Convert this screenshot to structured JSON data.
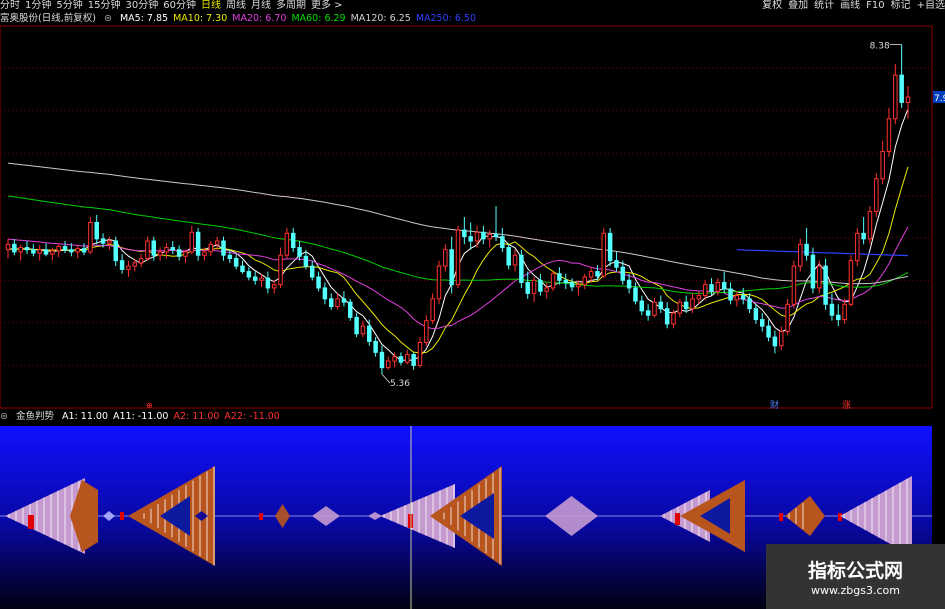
{
  "toolbar": {
    "periods": [
      "分时",
      "1分钟",
      "5分钟",
      "15分钟",
      "30分钟",
      "60分钟",
      "日线",
      "周线",
      "月线",
      "多周期",
      "更多 >"
    ],
    "active_period": "日线",
    "tools": [
      "复权",
      "叠加",
      "统计",
      "画线",
      "F10",
      "标记",
      "+自选"
    ]
  },
  "main_chart": {
    "title": "富奥股份(日线,前复权)",
    "ma_labels": [
      {
        "text": "MA5: 7.85",
        "color": "#ffffff"
      },
      {
        "text": "MA10: 7.30",
        "color": "#e8e800"
      },
      {
        "text": "MA20: 6.70",
        "color": "#e040e0"
      },
      {
        "text": "MA60: 6.29",
        "color": "#00e000"
      },
      {
        "text": "MA120: 6.25",
        "color": "#d0d0d0"
      },
      {
        "text": "MA250: 6.50",
        "color": "#3040ff"
      }
    ],
    "high_label": "8.38",
    "low_label": "5.36",
    "right_price": "7.9",
    "markers": [
      {
        "text": "财",
        "color": "#4a7cff"
      },
      {
        "text": "涨",
        "color": "#ff3030"
      }
    ],
    "small_marker": "⊕"
  },
  "sub_chart": {
    "title": "金鱼判势",
    "labels": [
      {
        "text": "A1: 11.00",
        "color": "#ffffff"
      },
      {
        "text": "A11: -11.00",
        "color": "#ffffff"
      },
      {
        "text": "A2: 11.00",
        "color": "#ff3030"
      },
      {
        "text": "A22: -11.00",
        "color": "#ff3030"
      }
    ]
  },
  "chart_data": {
    "type": "candlestick",
    "title": "富奥股份(日线,前复权)",
    "high": 8.38,
    "low": 5.36,
    "last_close": 7.9,
    "candles_ohlc": [
      [
        6.5,
        6.6,
        6.42,
        6.55
      ],
      [
        6.55,
        6.6,
        6.45,
        6.48
      ],
      [
        6.48,
        6.55,
        6.4,
        6.52
      ],
      [
        6.52,
        6.58,
        6.46,
        6.5
      ],
      [
        6.5,
        6.55,
        6.44,
        6.47
      ],
      [
        6.47,
        6.54,
        6.4,
        6.5
      ],
      [
        6.5,
        6.56,
        6.44,
        6.46
      ],
      [
        6.46,
        6.52,
        6.4,
        6.49
      ],
      [
        6.49,
        6.56,
        6.43,
        6.53
      ],
      [
        6.53,
        6.58,
        6.47,
        6.5
      ],
      [
        6.5,
        6.56,
        6.44,
        6.48
      ],
      [
        6.48,
        6.54,
        6.42,
        6.51
      ],
      [
        6.51,
        6.56,
        6.45,
        6.48
      ],
      [
        6.48,
        6.8,
        6.46,
        6.75
      ],
      [
        6.75,
        6.82,
        6.55,
        6.6
      ],
      [
        6.6,
        6.65,
        6.52,
        6.56
      ],
      [
        6.56,
        6.62,
        6.5,
        6.58
      ],
      [
        6.58,
        6.62,
        6.35,
        6.4
      ],
      [
        6.4,
        6.46,
        6.28,
        6.32
      ],
      [
        6.32,
        6.4,
        6.25,
        6.35
      ],
      [
        6.35,
        6.42,
        6.3,
        6.38
      ],
      [
        6.38,
        6.46,
        6.34,
        6.42
      ],
      [
        6.42,
        6.62,
        6.4,
        6.58
      ],
      [
        6.58,
        6.62,
        6.4,
        6.45
      ],
      [
        6.45,
        6.52,
        6.4,
        6.48
      ],
      [
        6.48,
        6.56,
        6.42,
        6.52
      ],
      [
        6.52,
        6.58,
        6.46,
        6.5
      ],
      [
        6.5,
        6.54,
        6.4,
        6.44
      ],
      [
        6.44,
        6.5,
        6.38,
        6.48
      ],
      [
        6.48,
        6.72,
        6.46,
        6.66
      ],
      [
        6.66,
        6.7,
        6.4,
        6.45
      ],
      [
        6.45,
        6.52,
        6.4,
        6.48
      ],
      [
        6.48,
        6.58,
        6.44,
        6.55
      ],
      [
        6.55,
        6.62,
        6.5,
        6.58
      ],
      [
        6.58,
        6.62,
        6.4,
        6.45
      ],
      [
        6.45,
        6.5,
        6.38,
        6.42
      ],
      [
        6.42,
        6.46,
        6.32,
        6.35
      ],
      [
        6.35,
        6.4,
        6.28,
        6.3
      ],
      [
        6.3,
        6.34,
        6.22,
        6.25
      ],
      [
        6.25,
        6.3,
        6.18,
        6.22
      ],
      [
        6.22,
        6.28,
        6.16,
        6.24
      ],
      [
        6.24,
        6.3,
        6.1,
        6.15
      ],
      [
        6.15,
        6.22,
        6.1,
        6.18
      ],
      [
        6.18,
        6.52,
        6.15,
        6.45
      ],
      [
        6.45,
        6.7,
        6.42,
        6.65
      ],
      [
        6.65,
        6.7,
        6.48,
        6.52
      ],
      [
        6.52,
        6.58,
        6.4,
        6.44
      ],
      [
        6.44,
        6.5,
        6.32,
        6.35
      ],
      [
        6.35,
        6.4,
        6.22,
        6.25
      ],
      [
        6.25,
        6.3,
        6.12,
        6.15
      ],
      [
        6.15,
        6.2,
        6.0,
        6.05
      ],
      [
        6.05,
        6.1,
        5.95,
        5.98
      ],
      [
        5.98,
        6.1,
        5.95,
        6.05
      ],
      [
        6.05,
        6.12,
        5.98,
        6.02
      ],
      [
        6.02,
        6.05,
        5.85,
        5.88
      ],
      [
        5.88,
        5.92,
        5.7,
        5.73
      ],
      [
        5.73,
        5.85,
        5.7,
        5.8
      ],
      [
        5.8,
        5.86,
        5.62,
        5.66
      ],
      [
        5.66,
        5.7,
        5.52,
        5.56
      ],
      [
        5.56,
        5.62,
        5.36,
        5.42
      ],
      [
        5.42,
        5.52,
        5.4,
        5.48
      ],
      [
        5.48,
        5.56,
        5.42,
        5.52
      ],
      [
        5.52,
        5.56,
        5.44,
        5.47
      ],
      [
        5.47,
        5.58,
        5.45,
        5.54
      ],
      [
        5.54,
        5.56,
        5.4,
        5.44
      ],
      [
        5.44,
        5.7,
        5.42,
        5.65
      ],
      [
        5.65,
        5.9,
        5.62,
        5.85
      ],
      [
        5.85,
        6.1,
        5.82,
        6.05
      ],
      [
        6.05,
        6.4,
        6.0,
        6.35
      ],
      [
        6.35,
        6.55,
        6.3,
        6.5
      ],
      [
        6.5,
        6.62,
        6.1,
        6.18
      ],
      [
        6.18,
        6.72,
        6.15,
        6.68
      ],
      [
        6.68,
        6.8,
        6.55,
        6.62
      ],
      [
        6.62,
        6.75,
        6.5,
        6.58
      ],
      [
        6.58,
        6.72,
        6.52,
        6.66
      ],
      [
        6.66,
        6.72,
        6.55,
        6.6
      ],
      [
        6.6,
        6.68,
        6.52,
        6.64
      ],
      [
        6.64,
        6.9,
        6.58,
        6.62
      ],
      [
        6.62,
        6.7,
        6.48,
        6.52
      ],
      [
        6.52,
        6.56,
        6.32,
        6.36
      ],
      [
        6.36,
        6.5,
        6.3,
        6.45
      ],
      [
        6.45,
        6.5,
        6.15,
        6.2
      ],
      [
        6.2,
        6.3,
        6.05,
        6.1
      ],
      [
        6.1,
        6.25,
        6.02,
        6.22
      ],
      [
        6.22,
        6.28,
        6.08,
        6.12
      ],
      [
        6.12,
        6.2,
        6.05,
        6.15
      ],
      [
        6.15,
        6.3,
        6.12,
        6.28
      ],
      [
        6.28,
        6.34,
        6.18,
        6.22
      ],
      [
        6.22,
        6.28,
        6.14,
        6.2
      ],
      [
        6.2,
        6.24,
        6.12,
        6.16
      ],
      [
        6.16,
        6.22,
        6.08,
        6.18
      ],
      [
        6.18,
        6.28,
        6.14,
        6.25
      ],
      [
        6.25,
        6.34,
        6.2,
        6.3
      ],
      [
        6.3,
        6.36,
        6.22,
        6.26
      ],
      [
        6.26,
        6.7,
        6.24,
        6.65
      ],
      [
        6.65,
        6.7,
        6.35,
        6.4
      ],
      [
        6.4,
        6.48,
        6.3,
        6.34
      ],
      [
        6.34,
        6.4,
        6.18,
        6.22
      ],
      [
        6.22,
        6.28,
        6.1,
        6.15
      ],
      [
        6.15,
        6.2,
        6.0,
        6.03
      ],
      [
        6.03,
        6.08,
        5.9,
        5.94
      ],
      [
        5.94,
        6.0,
        5.85,
        5.9
      ],
      [
        5.9,
        6.06,
        5.88,
        6.02
      ],
      [
        6.02,
        6.08,
        5.92,
        5.96
      ],
      [
        5.96,
        6.02,
        5.78,
        5.82
      ],
      [
        5.82,
        5.95,
        5.78,
        5.92
      ],
      [
        5.92,
        6.05,
        5.88,
        6.02
      ],
      [
        6.02,
        6.08,
        5.92,
        5.96
      ],
      [
        5.96,
        6.1,
        5.92,
        6.05
      ],
      [
        6.05,
        6.12,
        6.0,
        6.08
      ],
      [
        6.08,
        6.22,
        6.04,
        6.18
      ],
      [
        6.18,
        6.24,
        6.08,
        6.12
      ],
      [
        6.12,
        6.24,
        6.08,
        6.2
      ],
      [
        6.2,
        6.3,
        6.1,
        6.14
      ],
      [
        6.14,
        6.2,
        6.0,
        6.04
      ],
      [
        6.04,
        6.12,
        5.98,
        6.08
      ],
      [
        6.08,
        6.15,
        6.0,
        6.05
      ],
      [
        6.05,
        6.1,
        5.92,
        5.96
      ],
      [
        5.96,
        6.0,
        5.82,
        5.86
      ],
      [
        5.86,
        5.92,
        5.75,
        5.8
      ],
      [
        5.8,
        5.86,
        5.66,
        5.7
      ],
      [
        5.7,
        5.76,
        5.55,
        5.62
      ],
      [
        5.62,
        5.8,
        5.58,
        5.75
      ],
      [
        5.75,
        6.05,
        5.72,
        6.0
      ],
      [
        6.0,
        6.4,
        5.96,
        6.35
      ],
      [
        6.35,
        6.6,
        6.3,
        6.55
      ],
      [
        6.55,
        6.7,
        6.4,
        6.45
      ],
      [
        6.45,
        6.52,
        6.1,
        6.15
      ],
      [
        6.15,
        6.4,
        6.1,
        6.35
      ],
      [
        6.35,
        6.42,
        5.95,
        6.0
      ],
      [
        6.0,
        6.1,
        5.85,
        5.9
      ],
      [
        5.9,
        6.0,
        5.8,
        5.86
      ],
      [
        5.86,
        6.05,
        5.82,
        6.0
      ],
      [
        6.0,
        6.45,
        5.98,
        6.4
      ],
      [
        6.4,
        6.7,
        6.35,
        6.65
      ],
      [
        6.65,
        6.8,
        6.55,
        6.6
      ],
      [
        6.6,
        6.9,
        6.55,
        6.85
      ],
      [
        6.85,
        7.2,
        6.8,
        7.15
      ],
      [
        7.15,
        7.5,
        7.1,
        7.4
      ],
      [
        7.4,
        7.8,
        7.35,
        7.7
      ],
      [
        7.7,
        8.2,
        7.65,
        8.1
      ],
      [
        8.1,
        8.38,
        7.8,
        7.85
      ],
      [
        7.85,
        8.0,
        7.7,
        7.9
      ]
    ],
    "indicator": {
      "name": "金鱼判势",
      "A1": 11.0,
      "A11": -11.0,
      "A2": 11.0,
      "A22": -11.0
    }
  },
  "watermark": {
    "line1": "指标公式网",
    "line2": "www.zbgs3.com"
  }
}
